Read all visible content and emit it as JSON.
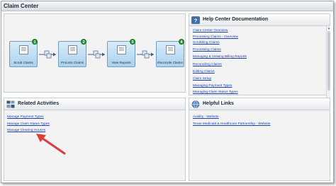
{
  "window": {
    "title": "Claim Center"
  },
  "workflow": {
    "steps": [
      {
        "number": "1",
        "label": "Scrub Claims"
      },
      {
        "number": "2",
        "label": "Process Claims"
      },
      {
        "number": "3",
        "label": "View Reports"
      },
      {
        "number": "4",
        "label": "Reconcile Claims"
      }
    ]
  },
  "help_center": {
    "title": "Help Center Documentation",
    "links": [
      "Claim Center Overview",
      "Processing Claims - Overview",
      "Scrubbing Claims",
      "Processing Claims",
      "Managing & Viewing Billing Reports",
      "Reconciling Claims",
      "Editing Claims",
      "Claim Setup",
      "Managing Payment Types",
      "Managing Claim Status Types"
    ]
  },
  "related_activities": {
    "title": "Related Activities",
    "links": [
      "Manage Payment Types",
      "Manage Claim Status Types",
      "Manage Clearing Houses"
    ]
  },
  "helpful_links": {
    "title": "Helpful Links",
    "links": [
      "Availity - Website",
      "Texas Medicaid & Healthcare Partnership - Website"
    ]
  },
  "colors": {
    "link": "#1a3fa6",
    "badge": "#2e9a3a",
    "arrow": "#e03a3a"
  },
  "icons": [
    "help-book-icon",
    "activities-icon",
    "globe-icon",
    "claim-document-icon",
    "transfer-arrow-icon"
  ]
}
